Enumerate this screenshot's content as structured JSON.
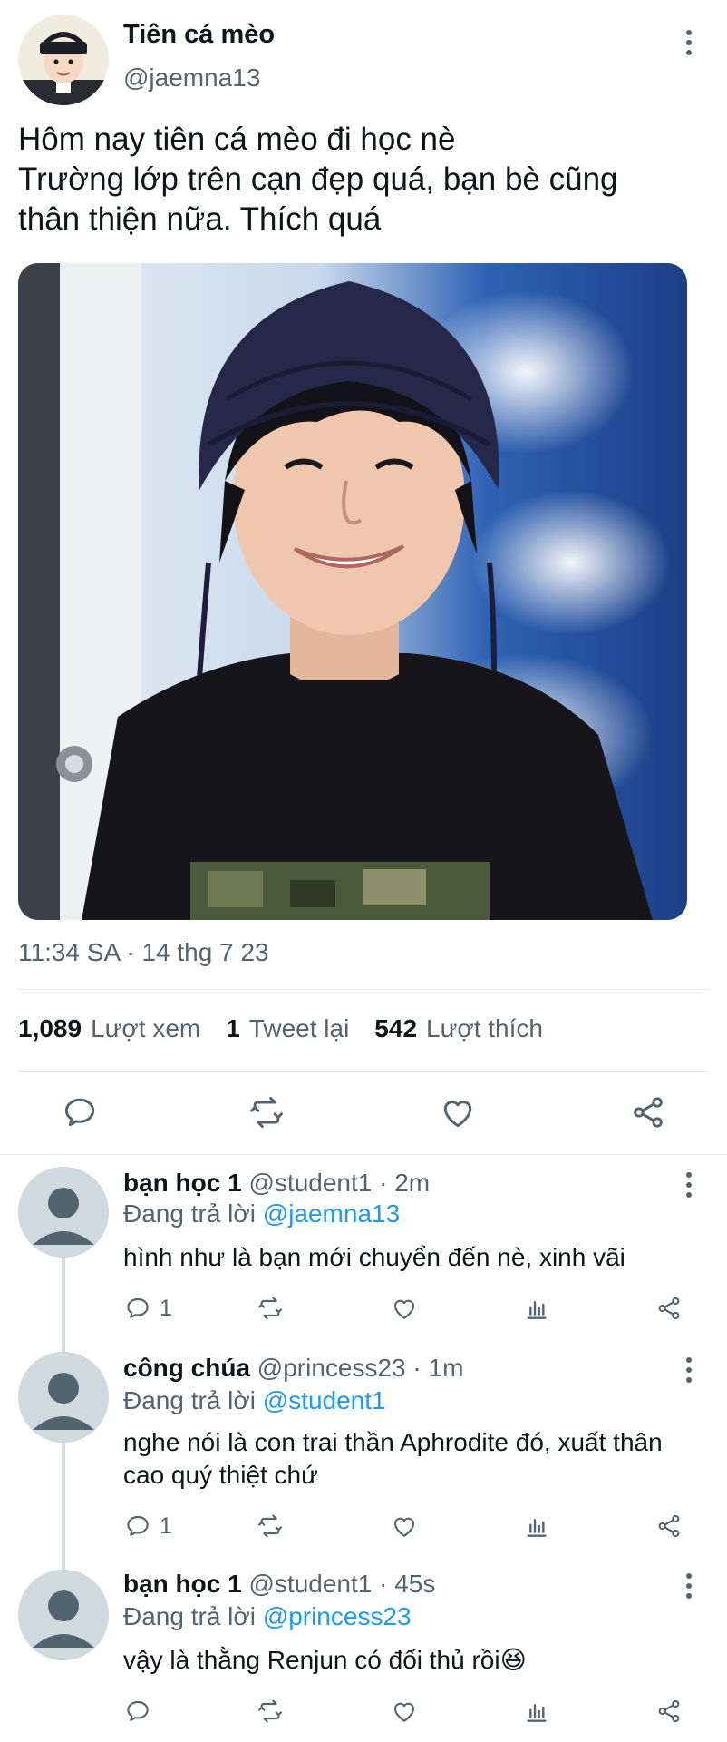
{
  "tweet": {
    "display_name": "Tiên cá mèo",
    "handle": "@jaemna13",
    "text_lines": [
      "Hôm nay tiên cá mèo đi học nè",
      "Trường lớp trên cạn đẹp quá, bạn bè cũng",
      "thân thiện nữa. Thích quá"
    ],
    "timestamp": "11:34 SA · 14 thg 7 23",
    "stats": {
      "views_count": "1,089",
      "views_label": "Lượt xem",
      "retweets_count": "1",
      "retweets_label": "Tweet lại",
      "likes_count": "542",
      "likes_label": "Lượt thích"
    },
    "actions": [
      "reply-icon",
      "retweet-icon",
      "like-icon",
      "share-icon"
    ]
  },
  "replies": [
    {
      "name": "bạn học 1",
      "handle": "@student1",
      "time": "· 2m",
      "replying_prefix": "Đang trả lời",
      "replying_to": "@jaemna13",
      "body_lines": [
        "hình như là bạn mới chuyển đến nè, xinh vãi"
      ],
      "reply_count": "1"
    },
    {
      "name": "công chúa",
      "handle": "@princess23",
      "time": "· 1m",
      "replying_prefix": "Đang trả lời",
      "replying_to": "@student1",
      "body_lines": [
        "nghe nói là con trai thần Aphrodite đó, xuất thân",
        "cao quý thiệt chứ"
      ],
      "reply_count": "1"
    },
    {
      "name": "bạn học 1",
      "handle": "@student1",
      "time": "· 45s",
      "replying_prefix": "Đang trả lời",
      "replying_to": "@princess23",
      "body_lines": [
        "vậy là thằng Renjun có đối thủ rồi😆"
      ],
      "reply_count": ""
    }
  ],
  "colors": {
    "text": "#0f1419",
    "secondary": "#536471",
    "link": "#1d9bf0",
    "divider": "#e7e9ea",
    "avatar_placeholder": "#cfd9de"
  }
}
